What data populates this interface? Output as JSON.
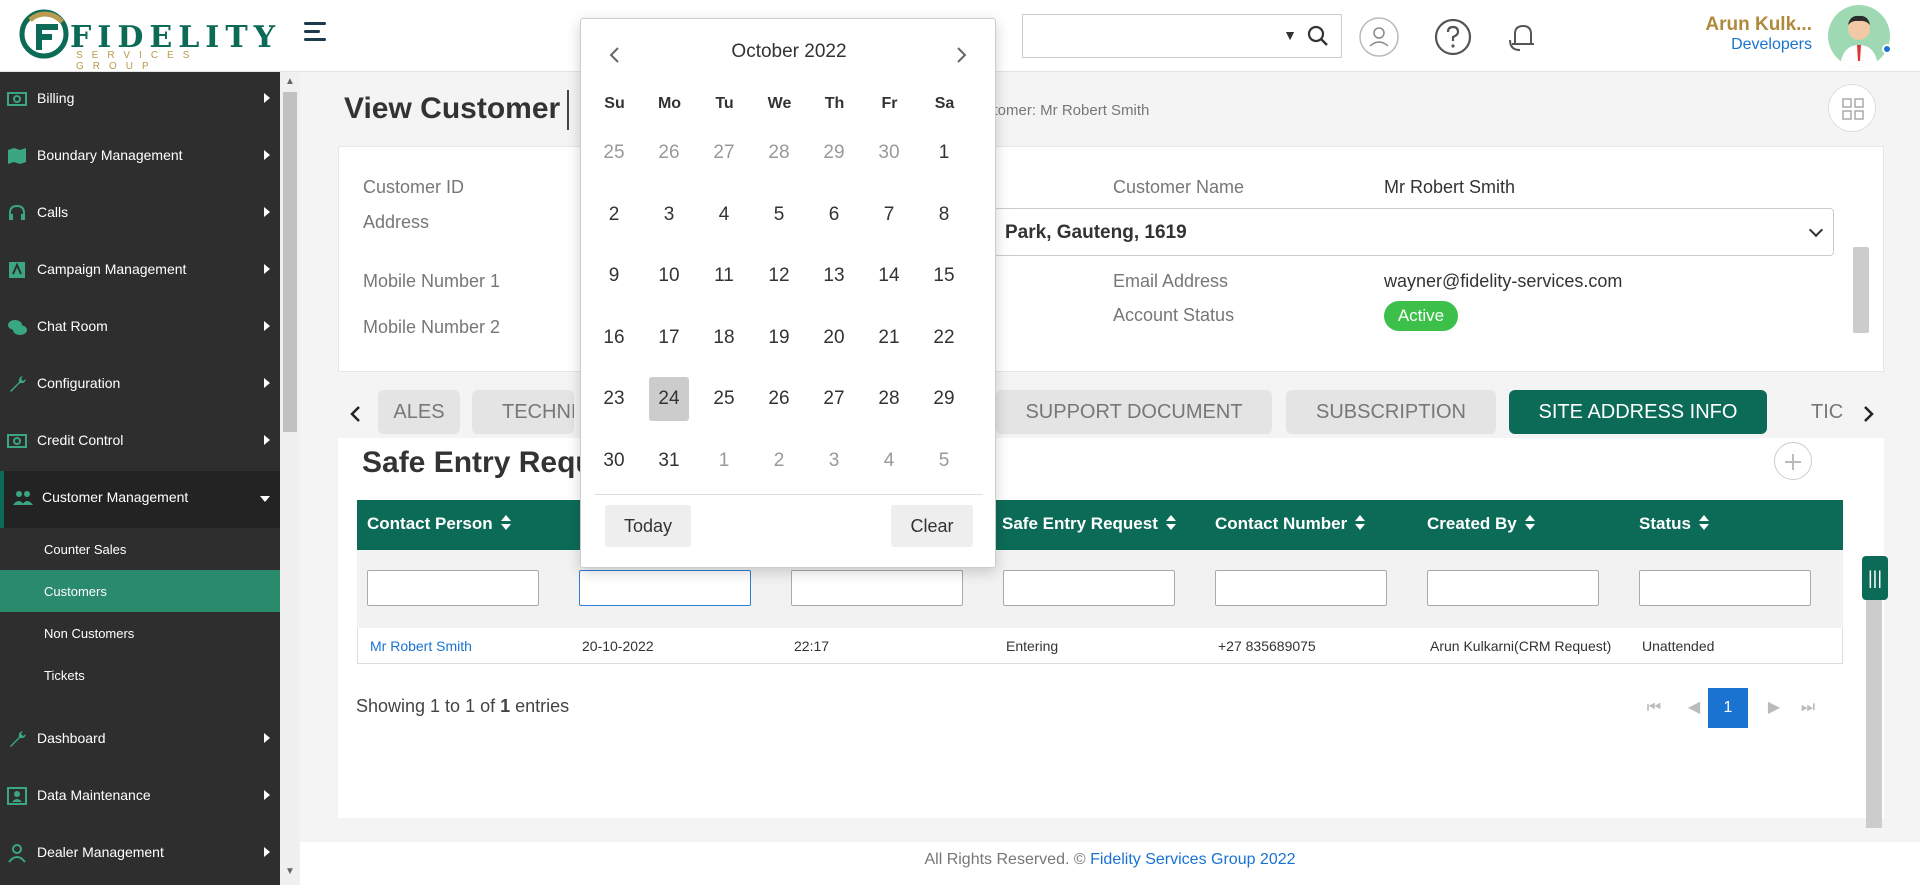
{
  "header": {
    "logo_text": "FIDELITY",
    "logo_sub": "SERVICES GROUP",
    "search_value": "",
    "user_name": "Arun Kulk...",
    "user_role": "Developers"
  },
  "sidebar": {
    "items": [
      {
        "label": "Billing",
        "icon": "money-icon"
      },
      {
        "label": "Boundary Management",
        "icon": "map-icon"
      },
      {
        "label": "Calls",
        "icon": "headset-icon"
      },
      {
        "label": "Campaign Management",
        "icon": "campaign-icon"
      },
      {
        "label": "Chat Room",
        "icon": "chat-icon"
      },
      {
        "label": "Configuration",
        "icon": "wrench-icon"
      },
      {
        "label": "Credit Control",
        "icon": "money-icon"
      },
      {
        "label": "Customer Management",
        "icon": "users-icon"
      },
      {
        "label": "Dashboard",
        "icon": "wrench-icon"
      },
      {
        "label": "Data Maintenance",
        "icon": "user-card-icon"
      },
      {
        "label": "Dealer Management",
        "icon": "user-icon"
      }
    ],
    "sub_items": [
      "Counter Sales",
      "Customers",
      "Non Customers",
      "Tickets"
    ]
  },
  "page": {
    "title": "View Customer",
    "breadcrumb": "stomer: Mr Robert Smith"
  },
  "info": {
    "customer_id_label": "Customer ID",
    "address_label": "Address",
    "mobile1_label": "Mobile Number 1",
    "mobile2_label": "Mobile Number 2",
    "customer_name_label": "Customer Name",
    "customer_name_value": "Mr Robert Smith",
    "address_value": "Park, Gauteng, 1619",
    "email_label": "Email Address",
    "email_value": "wayner@fidelity-services.com",
    "account_status_label": "Account Status",
    "account_status_value": "Active"
  },
  "tabs": [
    {
      "label": "ALES",
      "active": false
    },
    {
      "label": "TECHNI",
      "active": false
    },
    {
      "label": "SUPPORT DOCUMENT",
      "active": false
    },
    {
      "label": "SUBSCRIPTION",
      "active": false
    },
    {
      "label": "SITE ADDRESS INFO",
      "active": true
    },
    {
      "label": "TIC",
      "active": false
    }
  ],
  "section": {
    "title": "Safe Entry Reque"
  },
  "table": {
    "headers": [
      "Contact Person",
      "Safe Entry Request",
      "Contact Number",
      "Created By",
      "Status"
    ],
    "row": {
      "contact_person": "Mr Robert Smith",
      "date": "20-10-2022",
      "time": "22:17",
      "safe_entry_request": "Entering",
      "contact_number": "+27 835689075",
      "created_by": "Arun Kulkarni(CRM Request)",
      "status": "Unattended"
    }
  },
  "pagination": {
    "showing_prefix": "Showing 1 to 1 of ",
    "showing_total": "1",
    "showing_suffix": " entries",
    "current_page": "1"
  },
  "footer": {
    "text": "All Rights Reserved. © ",
    "link": "Fidelity Services Group 2022"
  },
  "datepicker": {
    "month_title": "October 2022",
    "weekdays": [
      "Su",
      "Mo",
      "Tu",
      "We",
      "Th",
      "Fr",
      "Sa"
    ],
    "weeks": [
      [
        "25",
        "26",
        "27",
        "28",
        "29",
        "30",
        "1"
      ],
      [
        "2",
        "3",
        "4",
        "5",
        "6",
        "7",
        "8"
      ],
      [
        "9",
        "10",
        "11",
        "12",
        "13",
        "14",
        "15"
      ],
      [
        "16",
        "17",
        "18",
        "19",
        "20",
        "21",
        "22"
      ],
      [
        "23",
        "24",
        "25",
        "26",
        "27",
        "28",
        "29"
      ],
      [
        "30",
        "31",
        "1",
        "2",
        "3",
        "4",
        "5"
      ]
    ],
    "selected": "24",
    "today_label": "Today",
    "clear_label": "Clear"
  },
  "colors": {
    "brand_green": "#0c6b57",
    "accent_blue": "#1a73d1",
    "active_badge": "#3cc04a",
    "sidebar_bg": "#2e2e2e"
  }
}
